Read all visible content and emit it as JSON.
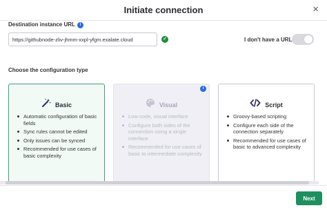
{
  "dialog": {
    "title": "Initiate connection",
    "close_icon": "close-icon"
  },
  "destination": {
    "label": "Destination instance URL",
    "info_icon": "info-icon",
    "url_value": "https://githubnode-zliv-jhmm-xxpl-yfgm.exalate.cloud",
    "valid_icon": "check-circle-icon",
    "no_url_label": "I don't have a URL",
    "toggle_on": false
  },
  "config": {
    "label": "Choose the configuration type",
    "cards": [
      {
        "title": "Basic",
        "icon": "magic-wand-icon",
        "selected": true,
        "disabled": false,
        "items": [
          "Automatic configuration of basic fields",
          "Sync rules cannot be edited",
          "Only issues can be synced",
          "Recommended for use cases of basic complexity"
        ]
      },
      {
        "title": "Visual",
        "icon": "palette-icon",
        "selected": false,
        "disabled": true,
        "items": [
          "Low-code, visual interface",
          "Configure both sides of the connection using a single interface",
          "Recommended for use cases of basic to intermediate complexity"
        ]
      },
      {
        "title": "Script",
        "icon": "code-icon",
        "selected": false,
        "disabled": false,
        "items": [
          "Groovy-based scripting",
          "Configure each side of the connection separately",
          "Recommended for use cases of basic to advanced complexity"
        ]
      }
    ]
  },
  "footer": {
    "next_label": "Next"
  },
  "colors": {
    "accent": "#1f8f5f",
    "selected_border": "#3ca07d",
    "info": "#2b6cd8"
  }
}
